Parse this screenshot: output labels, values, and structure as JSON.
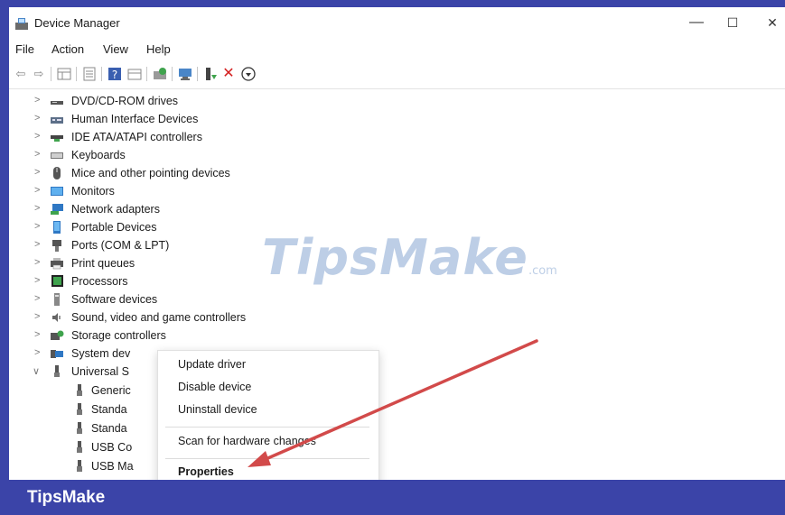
{
  "window": {
    "title": "Device Manager",
    "controls": {
      "minimize": "—",
      "maximize": "☐",
      "close": "✕"
    }
  },
  "menu": [
    "File",
    "Action",
    "View",
    "Help"
  ],
  "toolbar": {
    "icons": [
      "back-icon",
      "forward-icon",
      "show-hide-icon",
      "properties-icon",
      "help-icon",
      "view-icon",
      "update-driver-icon",
      "scan-hardware-icon",
      "add-driver-icon",
      "uninstall-icon",
      "enable-device-icon"
    ]
  },
  "tree": {
    "categories": [
      {
        "label": "DVD/CD-ROM drives",
        "icon": "dvd-drive-icon"
      },
      {
        "label": "Human Interface Devices",
        "icon": "hid-icon"
      },
      {
        "label": "IDE ATA/ATAPI controllers",
        "icon": "ide-controller-icon"
      },
      {
        "label": "Keyboards",
        "icon": "keyboard-icon"
      },
      {
        "label": "Mice and other pointing devices",
        "icon": "mouse-icon"
      },
      {
        "label": "Monitors",
        "icon": "monitor-icon"
      },
      {
        "label": "Network adapters",
        "icon": "network-adapter-icon"
      },
      {
        "label": "Portable Devices",
        "icon": "portable-device-icon"
      },
      {
        "label": "Ports (COM & LPT)",
        "icon": "port-icon"
      },
      {
        "label": "Print queues",
        "icon": "printer-icon"
      },
      {
        "label": "Processors",
        "icon": "processor-icon"
      },
      {
        "label": "Software devices",
        "icon": "software-device-icon"
      },
      {
        "label": "Sound, video and game controllers",
        "icon": "sound-icon"
      },
      {
        "label": "Storage controllers",
        "icon": "storage-icon"
      },
      {
        "label": "System dev",
        "icon": "system-device-icon"
      },
      {
        "label": "Universal S",
        "icon": "usb-icon"
      }
    ],
    "usb_children": [
      {
        "label": "Generic"
      },
      {
        "label": "Standa"
      },
      {
        "label": "Standa"
      },
      {
        "label": "USB Co"
      },
      {
        "label": "USB Ma"
      }
    ]
  },
  "context_menu": {
    "items": [
      "Update driver",
      "Disable device",
      "Uninstall device",
      "Scan for hardware changes",
      "Properties"
    ]
  },
  "watermark": {
    "main": "TipsMake",
    "suffix": ".com"
  },
  "footer": {
    "brand": "TipsMake"
  },
  "colors": {
    "frame": "#3b44a8",
    "arrow": "#d24a4a",
    "watermark": "#6e94c8"
  }
}
